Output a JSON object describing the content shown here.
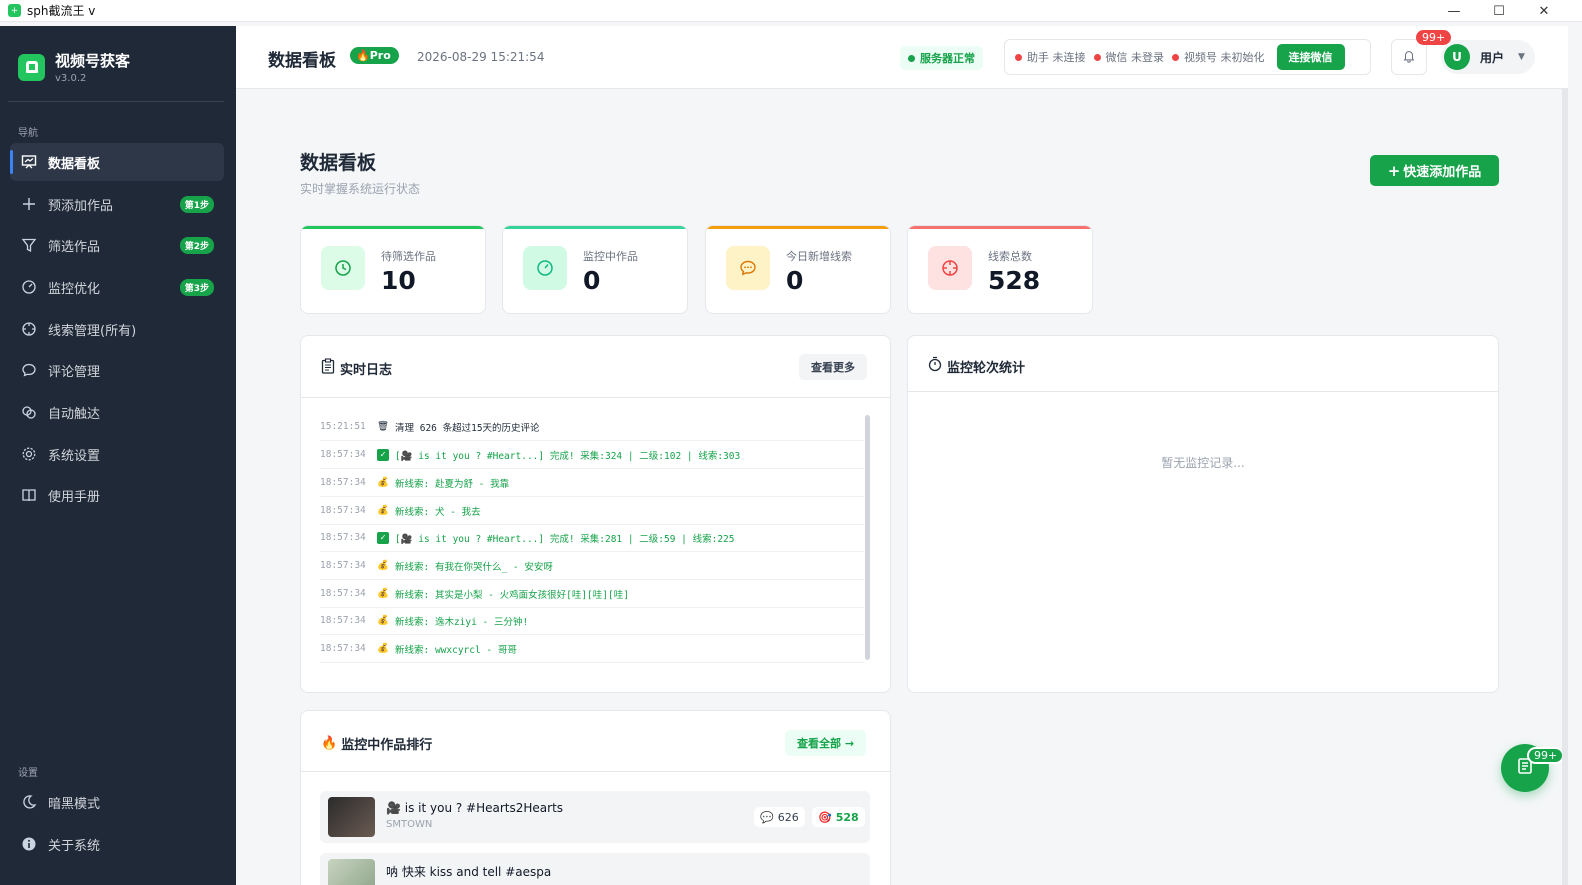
{
  "window": {
    "title": "sph截流王 v"
  },
  "brand": {
    "name": "视频号获客",
    "version": "v3.0.2"
  },
  "sidebar": {
    "nav_section": "导航",
    "settings_section": "设置",
    "items": [
      {
        "label": "数据看板",
        "icon": "chart-board-icon",
        "active": true
      },
      {
        "label": "预添加作品",
        "icon": "plus-icon",
        "badge": "第1步"
      },
      {
        "label": "筛选作品",
        "icon": "filter-icon",
        "badge": "第2步"
      },
      {
        "label": "监控优化",
        "icon": "gauge-icon",
        "badge": "第3步"
      },
      {
        "label": "线索管理(所有)",
        "icon": "target-icon"
      },
      {
        "label": "评论管理",
        "icon": "comment-icon"
      },
      {
        "label": "自动触达",
        "icon": "link-icon"
      },
      {
        "label": "系统设置",
        "icon": "gear-icon"
      },
      {
        "label": "使用手册",
        "icon": "book-icon"
      }
    ],
    "bottom_items": [
      {
        "label": "暗黑模式",
        "icon": "moon-icon"
      },
      {
        "label": "关于系统",
        "icon": "info-icon"
      }
    ]
  },
  "header": {
    "title": "数据看板",
    "pro_label": "Pro",
    "datetime": "2026-08-29 15:21:54",
    "server_status": "服务器正常",
    "statuses": [
      "助手 未连接",
      "微信 未登录",
      "视频号 未初始化"
    ],
    "connect_label": "连接微信",
    "notif_count": "99+",
    "avatar_letter": "U",
    "user_label": "用户"
  },
  "main": {
    "title": "数据看板",
    "subtitle": "实时掌握系统运行状态",
    "quick_add_label": "快速添加作品"
  },
  "stats": [
    {
      "label": "待筛选作品",
      "value": "10",
      "color": "#22c55e",
      "icon": "clock-icon"
    },
    {
      "label": "监控中作品",
      "value": "0",
      "color": "#34d399",
      "icon": "gauge-icon"
    },
    {
      "label": "今日新增线索",
      "value": "0",
      "color": "#f59e0b",
      "icon": "chat-icon"
    },
    {
      "label": "线索总数",
      "value": "528",
      "color": "#f87171",
      "icon": "crosshair-icon"
    }
  ],
  "log": {
    "title": "实时日志",
    "more_label": "查看更多",
    "rows": [
      {
        "time": "15:21:51",
        "icon": "trash-icon",
        "msg": "清理 626 条超过15天的历史评论",
        "color": "#1f2937"
      },
      {
        "time": "18:57:34",
        "icon": "check-icon",
        "msg": "[🎥 is it you ? #Heart...] 完成! 采集:324 | 二级:102 | 线索:303",
        "color": "#16a34a"
      },
      {
        "time": "18:57:34",
        "icon": "money-bag-icon",
        "msg": "新线索: 赴夏为舒 - 我靠",
        "color": "#16a34a"
      },
      {
        "time": "18:57:34",
        "icon": "money-bag-icon",
        "msg": "新线索: 犬 - 我去",
        "color": "#16a34a"
      },
      {
        "time": "18:57:34",
        "icon": "check-icon",
        "msg": "[🎥 is it you ? #Heart...] 完成! 采集:281 | 二级:59 | 线索:225",
        "color": "#16a34a"
      },
      {
        "time": "18:57:34",
        "icon": "money-bag-icon",
        "msg": "新线索: 有我在你哭什么_ - 安安呀",
        "color": "#16a34a"
      },
      {
        "time": "18:57:34",
        "icon": "money-bag-icon",
        "msg": "新线索: 其实是小梨 - 火鸡面女孩很好[哇][哇][哇]",
        "color": "#16a34a"
      },
      {
        "time": "18:57:34",
        "icon": "money-bag-icon",
        "msg": "新线索: 逸木ziyi - 三分钟!",
        "color": "#16a34a"
      },
      {
        "time": "18:57:34",
        "icon": "money-bag-icon",
        "msg": "新线索: wwxcyrcl - 哥哥",
        "color": "#16a34a"
      }
    ]
  },
  "monitor_stats": {
    "title": "监控轮次统计",
    "empty": "暂无监控记录..."
  },
  "ranking": {
    "title": "监控中作品排行",
    "more_label": "查看全部 →",
    "items": [
      {
        "title": "🎥 is it you ? #Hearts2Hearts",
        "author": "SMTOWN",
        "comments": "626",
        "leads": "528"
      },
      {
        "title": "呐 快来 kiss and tell #aespa",
        "author": "",
        "comments": "",
        "leads": ""
      }
    ]
  },
  "fab": {
    "badge": "99+",
    "icon": "document-icon"
  }
}
